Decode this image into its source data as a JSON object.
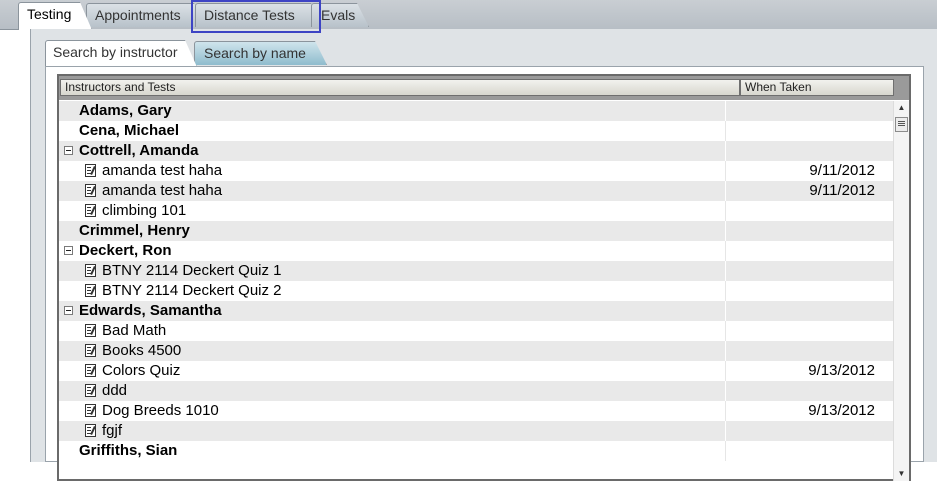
{
  "top_tabs": [
    {
      "label": "Testing",
      "active": true
    },
    {
      "label": "Appointments",
      "active": false
    },
    {
      "label": "Distance Tests",
      "active": false
    },
    {
      "label": "Evals",
      "active": false
    }
  ],
  "sub_tabs": [
    {
      "label": "Search by instructor",
      "active": true
    },
    {
      "label": "Search by name",
      "active": false
    }
  ],
  "grid": {
    "columns": [
      "Instructors and Tests",
      "When Taken"
    ],
    "rows": [
      {
        "type": "group",
        "label": "Adams, Gary",
        "date": ""
      },
      {
        "type": "group",
        "label": "Cena, Michael",
        "date": ""
      },
      {
        "type": "group",
        "label": "Cottrell, Amanda",
        "date": "",
        "expanded": true
      },
      {
        "type": "item",
        "label": "amanda test haha",
        "date": "9/11/2012"
      },
      {
        "type": "item",
        "label": "amanda test haha",
        "date": "9/11/2012"
      },
      {
        "type": "item",
        "label": "climbing 101",
        "date": ""
      },
      {
        "type": "group",
        "label": "Crimmel, Henry",
        "date": ""
      },
      {
        "type": "group",
        "label": "Deckert, Ron",
        "date": "",
        "expanded": true
      },
      {
        "type": "item",
        "label": "BTNY 2114 Deckert Quiz 1",
        "date": ""
      },
      {
        "type": "item",
        "label": "BTNY 2114 Deckert Quiz 2",
        "date": ""
      },
      {
        "type": "group",
        "label": "Edwards, Samantha",
        "date": "",
        "expanded": true
      },
      {
        "type": "item",
        "label": "Bad Math",
        "date": ""
      },
      {
        "type": "item",
        "label": "Books 4500",
        "date": ""
      },
      {
        "type": "item",
        "label": "Colors Quiz",
        "date": "9/13/2012"
      },
      {
        "type": "item",
        "label": "ddd",
        "date": ""
      },
      {
        "type": "item",
        "label": "Dog Breeds 1010",
        "date": "9/13/2012"
      },
      {
        "type": "item",
        "label": "fgjf",
        "date": ""
      },
      {
        "type": "group",
        "label": "Griffiths, Sian",
        "date": ""
      }
    ]
  },
  "icons": {
    "expander": "collapse-minus-icon",
    "test": "test-document-icon",
    "scroll_up": "scroll-up-arrow-icon",
    "scroll_down": "scroll-down-arrow-icon"
  }
}
